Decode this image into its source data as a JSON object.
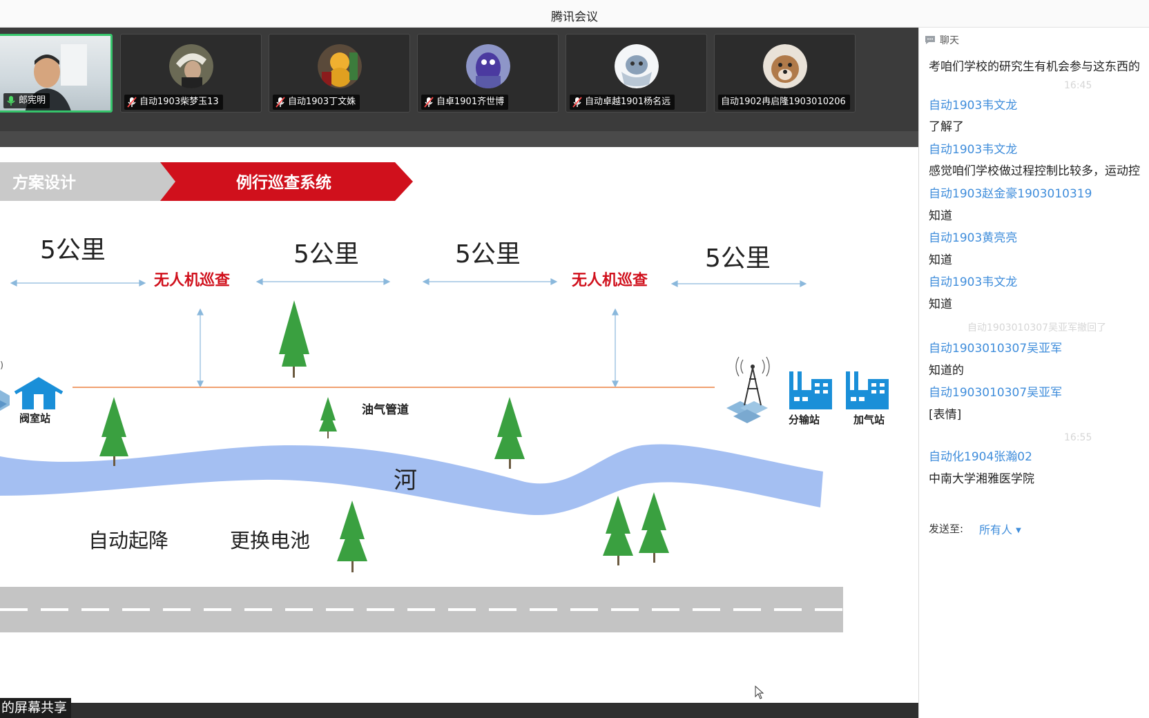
{
  "window": {
    "title": "腾讯会议"
  },
  "participants": [
    {
      "name": "郎宪明",
      "active": true
    },
    {
      "name": "自动1903柴梦玉13",
      "muted": true
    },
    {
      "name": "自动1903丁文姝",
      "muted": true
    },
    {
      "name": "自卓1901齐世博",
      "muted": true
    },
    {
      "name": "自动卓越1901杨名远",
      "muted": true
    },
    {
      "name": "自动1902冉启隆1903010206",
      "muted": false
    }
  ],
  "slide": {
    "tab_left": "方案设计",
    "tab_right": "例行巡查系统",
    "distance_1": "5公里",
    "distance_2": "5公里",
    "distance_3": "5公里",
    "distance_4": "5公里",
    "drone_1": "无人机巡查",
    "drone_2": "无人机巡查",
    "valve_station": "阀室站",
    "pipeline": "油气管道",
    "distribution_station": "分输站",
    "gas_station": "加气站",
    "river": "河",
    "auto_takeoff": "自动起降",
    "battery_swap": "更换电池",
    "colors": {
      "accent_red": "#d0101c",
      "river_blue": "#a4bff2",
      "pipeline_orange": "#f0a070",
      "icon_blue": "#1a8fd8",
      "tree_green": "#3aa040"
    }
  },
  "share_label": "的屏幕共享",
  "chat": {
    "header": "聊天",
    "messages": [
      {
        "type": "msg",
        "text": "考咱们学校的研究生有机会参与这东西的"
      },
      {
        "type": "ghost",
        "text": "16:45"
      },
      {
        "type": "sender",
        "text": "自动1903韦文龙"
      },
      {
        "type": "msg",
        "text": "了解了"
      },
      {
        "type": "sender",
        "text": "自动1903韦文龙"
      },
      {
        "type": "msg",
        "text": "感觉咱们学校做过程控制比较多，运动控"
      },
      {
        "type": "sender",
        "text": "自动1903赵金豪1903010319"
      },
      {
        "type": "msg",
        "text": "知道"
      },
      {
        "type": "sender",
        "text": "自动1903黄亮亮"
      },
      {
        "type": "msg",
        "text": "知道"
      },
      {
        "type": "sender",
        "text": "自动1903韦文龙"
      },
      {
        "type": "msg",
        "text": "知道"
      },
      {
        "type": "ghost",
        "text": "自动1903010307吴亚军撤回了"
      },
      {
        "type": "sender",
        "text": "自动1903010307吴亚军"
      },
      {
        "type": "msg",
        "text": "知道的"
      },
      {
        "type": "sender",
        "text": "自动1903010307吴亚军"
      },
      {
        "type": "msg",
        "text": "[表情]"
      },
      {
        "type": "ghost",
        "text": "16:55"
      },
      {
        "type": "sender",
        "text": "自动化1904张瀚02"
      },
      {
        "type": "msg",
        "text": "中南大学湘雅医学院"
      }
    ],
    "send_to_label": "发送至:",
    "send_to_value": "所有人"
  }
}
